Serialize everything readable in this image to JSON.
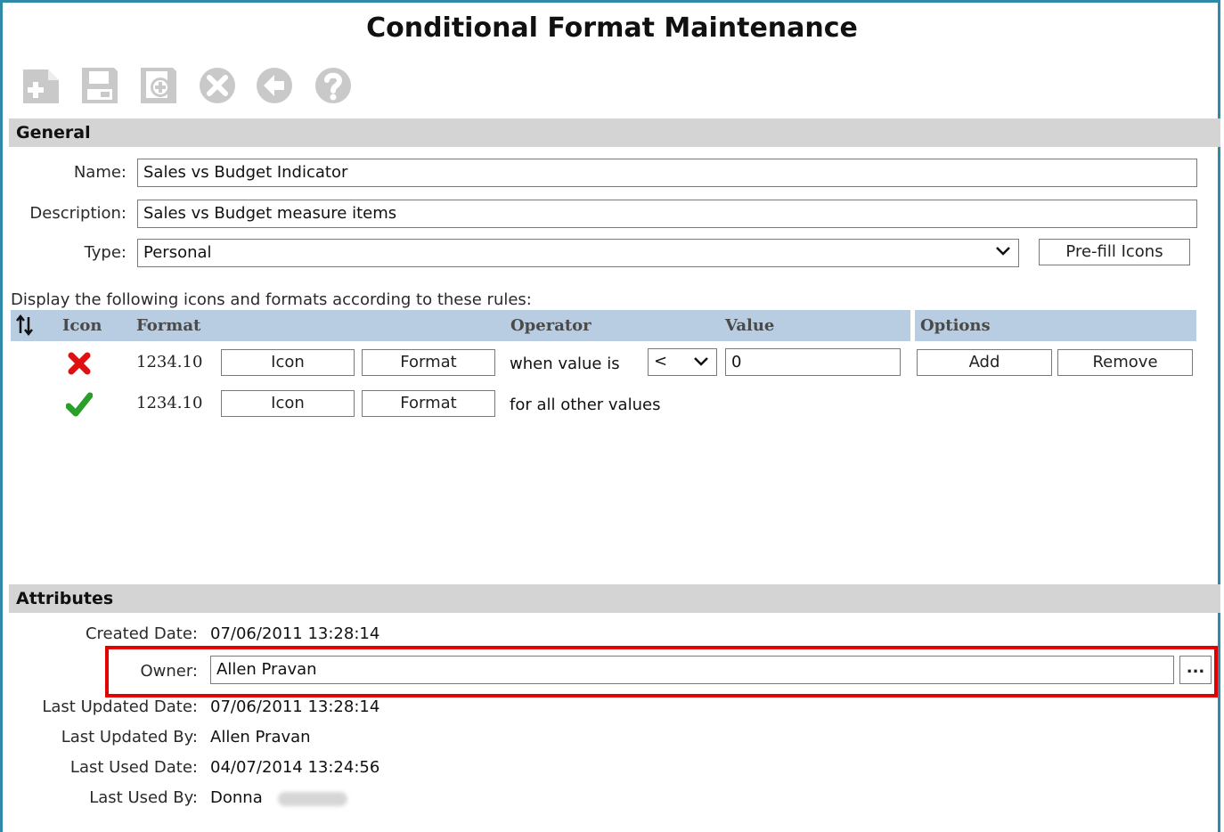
{
  "title": "Conditional Format Maintenance",
  "toolbar": {
    "icons": [
      "new-icon",
      "save-icon",
      "save-as-icon",
      "cancel-icon",
      "back-icon",
      "help-icon"
    ]
  },
  "general": {
    "section_label": "General",
    "name_label": "Name:",
    "name_value": "Sales vs Budget Indicator",
    "description_label": "Description:",
    "description_value": "Sales vs Budget measure items",
    "type_label": "Type:",
    "type_value": "Personal",
    "prefill_label": "Pre-fill Icons",
    "rules_caption": "Display the following icons and formats according to these rules:"
  },
  "rules_grid": {
    "headers": {
      "icon": "Icon",
      "format": "Format",
      "operator": "Operator",
      "value": "Value",
      "options": "Options"
    },
    "rows": [
      {
        "icon": "red-x-icon",
        "sample": "1234.10",
        "icon_button": "Icon",
        "format_button": "Format",
        "condition": "when value is",
        "operator": "<",
        "value": "0",
        "add_button": "Add",
        "remove_button": "Remove"
      },
      {
        "icon": "green-check-icon",
        "sample": "1234.10",
        "icon_button": "Icon",
        "format_button": "Format",
        "condition": "for all other values"
      }
    ]
  },
  "attributes": {
    "section_label": "Attributes",
    "created_date_label": "Created Date:",
    "created_date": "07/06/2011 13:28:14",
    "owner_label": "Owner:",
    "owner_value": "Allen Pravan",
    "owner_browse": "...",
    "last_updated_date_label": "Last Updated Date:",
    "last_updated_date": "07/06/2011 13:28:14",
    "last_updated_by_label": "Last Updated By:",
    "last_updated_by": "Allen Pravan",
    "last_used_date_label": "Last Used Date:",
    "last_used_date": "04/07/2014 13:24:56",
    "last_used_by_label": "Last Used By:",
    "last_used_by": "Donna"
  },
  "colors": {
    "frame": "#2f8aa8",
    "section_bar": "#d4d4d4",
    "grid_header": "#b9cde2",
    "highlight": "#e30000",
    "toolbar_icon": "#c8c8c8"
  }
}
